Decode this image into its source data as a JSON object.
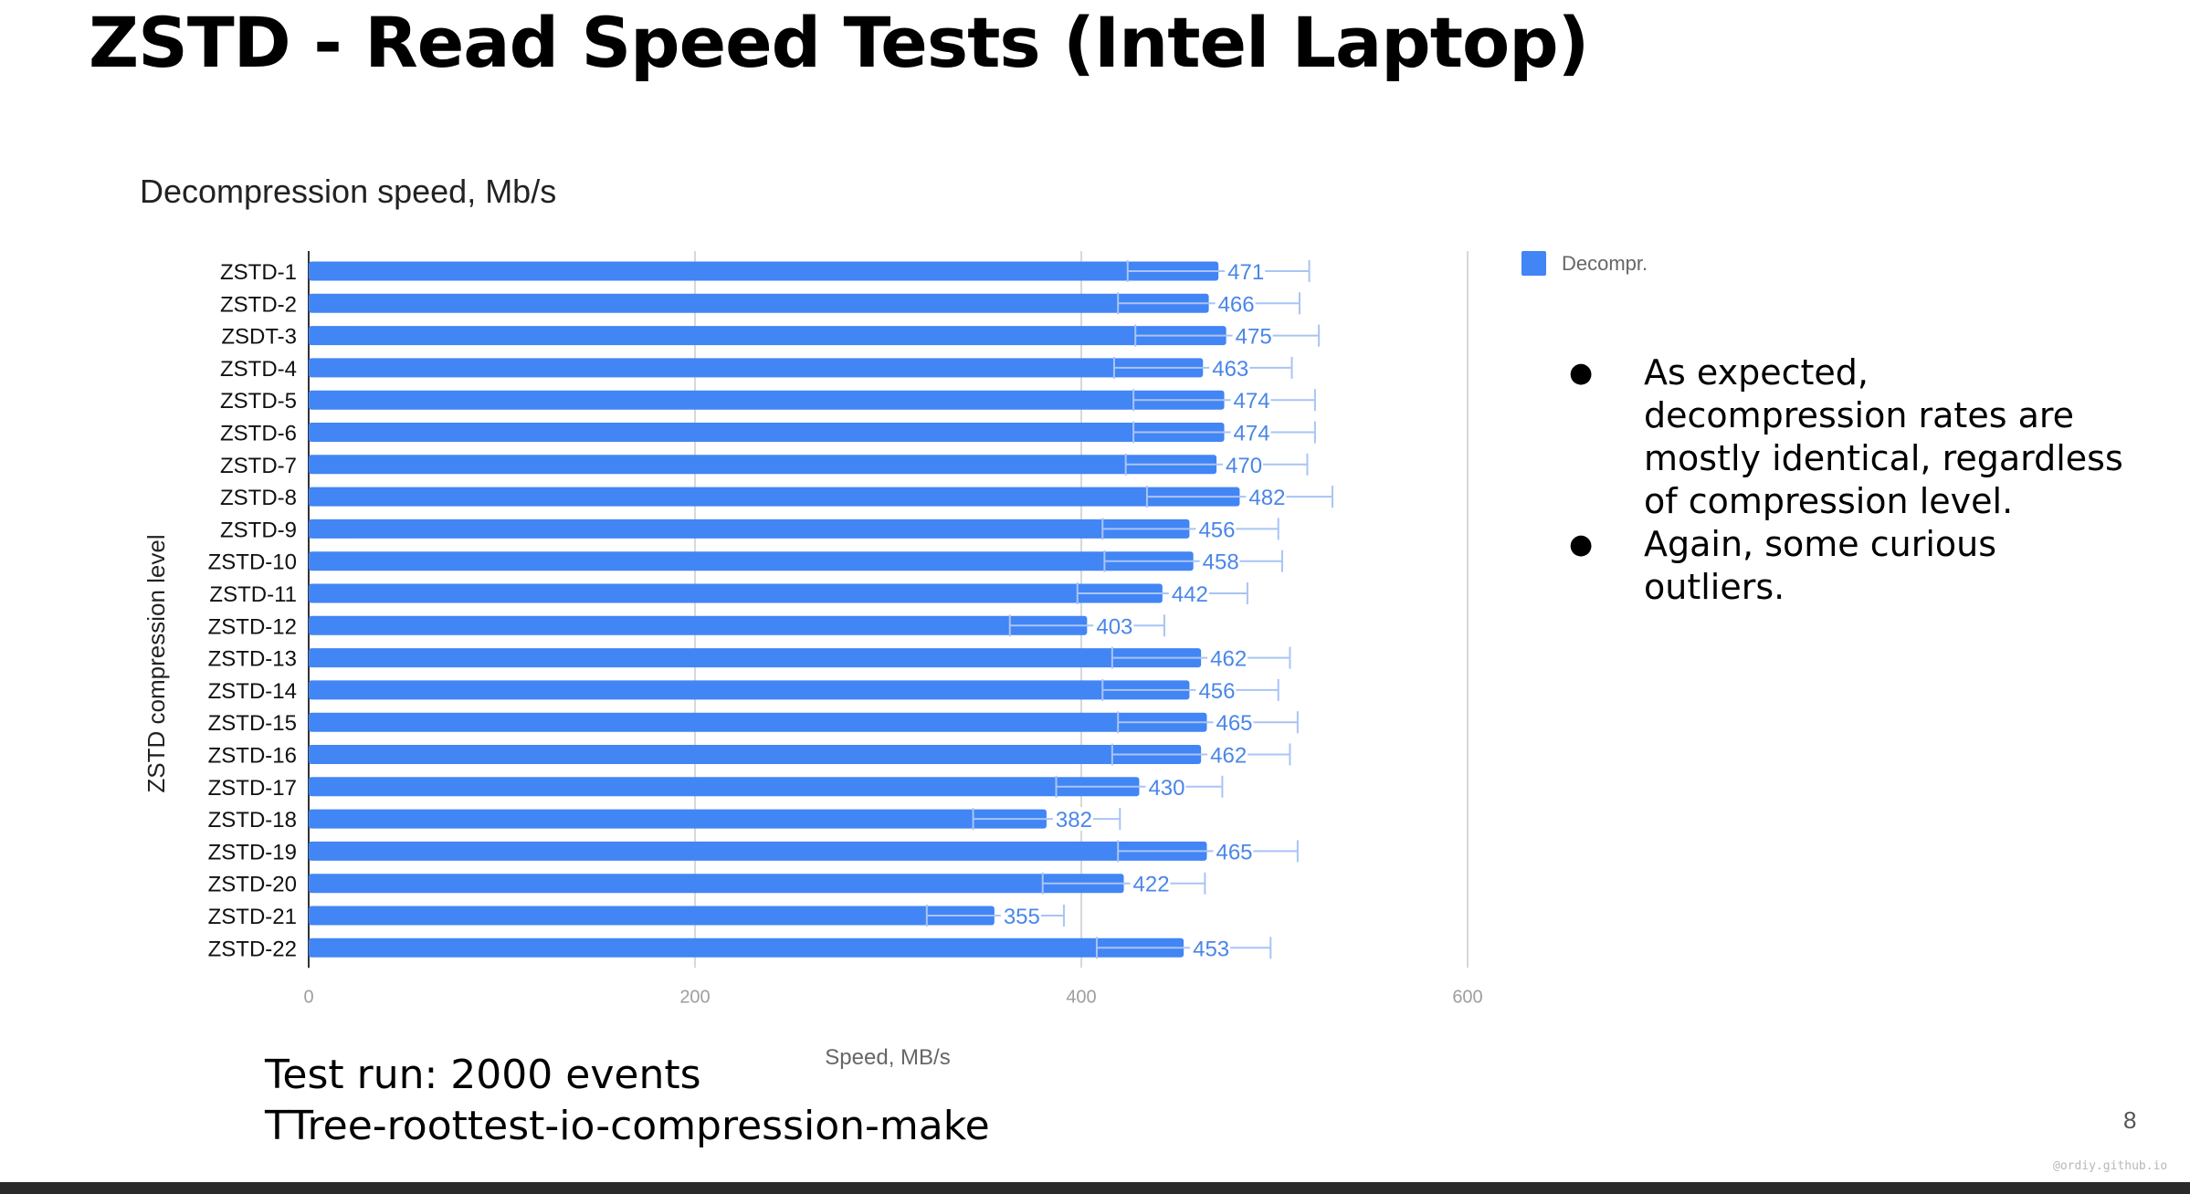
{
  "slide": {
    "title": "ZSTD - Read Speed Tests (Intel Laptop)",
    "bullets": [
      "As expected, decompression rates are mostly identical, regardless of compression level.",
      "Again, some curious outliers."
    ],
    "footnote_line1": "Test run: 2000 events",
    "footnote_line2": "TTree-roottest-io-compression-make",
    "page_number": "8",
    "credit": "@ordiy.github.io"
  },
  "colors": {
    "bar": "#4285f4",
    "label": "#4a86e8",
    "axis": "#9e9e9e",
    "grid": "#cccccc",
    "bottom_bar": "#2a2a2a"
  },
  "chart_data": {
    "type": "bar",
    "orientation": "horizontal",
    "title": "Decompression speed, Mb/s",
    "xlabel": "Speed, MB/s",
    "ylabel": "ZSTD compression level",
    "categories": [
      "ZSTD-1",
      "ZSTD-2",
      "ZSDT-3",
      "ZSTD-4",
      "ZSTD-5",
      "ZSTD-6",
      "ZSTD-7",
      "ZSTD-8",
      "ZSTD-9",
      "ZSTD-10",
      "ZSTD-11",
      "ZSTD-12",
      "ZSTD-13",
      "ZSTD-14",
      "ZSTD-15",
      "ZSTD-16",
      "ZSTD-17",
      "ZSTD-18",
      "ZSTD-19",
      "ZSTD-20",
      "ZSTD-21",
      "ZSTD-22"
    ],
    "series": [
      {
        "name": "Decompr.",
        "values": [
          471,
          466,
          475,
          463,
          474,
          474,
          470,
          482,
          456,
          458,
          442,
          403,
          462,
          456,
          465,
          462,
          430,
          382,
          465,
          422,
          355,
          453
        ],
        "error_low": [
          424,
          419,
          428,
          417,
          427,
          427,
          423,
          434,
          411,
          412,
          398,
          363,
          416,
          411,
          419,
          416,
          387,
          344,
          419,
          380,
          320,
          408
        ],
        "error_high": [
          518,
          513,
          523,
          509,
          521,
          521,
          517,
          530,
          502,
          504,
          486,
          443,
          508,
          502,
          512,
          508,
          473,
          420,
          512,
          464,
          391,
          498
        ]
      }
    ],
    "xlim": [
      0,
      600
    ],
    "xticks": [
      0,
      200,
      400,
      600
    ],
    "legend_position": "right",
    "grid": true
  }
}
